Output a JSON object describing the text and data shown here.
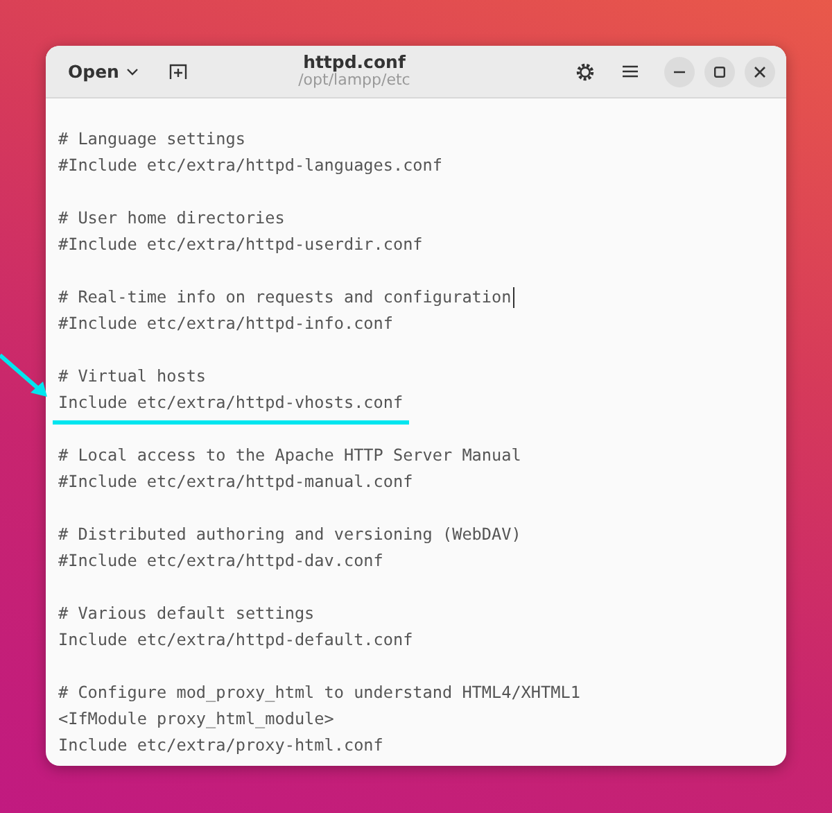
{
  "window": {
    "title": "httpd.conf",
    "subtitle": "/opt/lampp/etc",
    "open_button": "Open"
  },
  "blocks": [
    [
      {
        "text": "# Language settings",
        "highlighted": false,
        "cursor": false
      },
      {
        "text": "#Include etc/extra/httpd-languages.conf",
        "highlighted": false,
        "cursor": false
      }
    ],
    [
      {
        "text": "# User home directories",
        "highlighted": false,
        "cursor": false
      },
      {
        "text": "#Include etc/extra/httpd-userdir.conf",
        "highlighted": false,
        "cursor": false
      }
    ],
    [
      {
        "text": "# Real-time info on requests and configuration",
        "highlighted": false,
        "cursor": true
      },
      {
        "text": "#Include etc/extra/httpd-info.conf",
        "highlighted": false,
        "cursor": false
      }
    ],
    [
      {
        "text": "# Virtual hosts",
        "highlighted": false,
        "cursor": false
      },
      {
        "text": "Include etc/extra/httpd-vhosts.conf",
        "highlighted": true,
        "cursor": false
      }
    ],
    [
      {
        "text": "# Local access to the Apache HTTP Server Manual",
        "highlighted": false,
        "cursor": false
      },
      {
        "text": "#Include etc/extra/httpd-manual.conf",
        "highlighted": false,
        "cursor": false
      }
    ],
    [
      {
        "text": "# Distributed authoring and versioning (WebDAV)",
        "highlighted": false,
        "cursor": false
      },
      {
        "text": "#Include etc/extra/httpd-dav.conf",
        "highlighted": false,
        "cursor": false
      }
    ],
    [
      {
        "text": "# Various default settings",
        "highlighted": false,
        "cursor": false
      },
      {
        "text": "Include etc/extra/httpd-default.conf",
        "highlighted": false,
        "cursor": false
      }
    ],
    [
      {
        "text": "# Configure mod_proxy_html to understand HTML4/XHTML1",
        "highlighted": false,
        "cursor": false
      },
      {
        "text": "<IfModule proxy_html_module>",
        "highlighted": false,
        "cursor": false
      },
      {
        "text": "Include etc/extra/proxy-html.conf",
        "highlighted": false,
        "cursor": false
      }
    ]
  ]
}
